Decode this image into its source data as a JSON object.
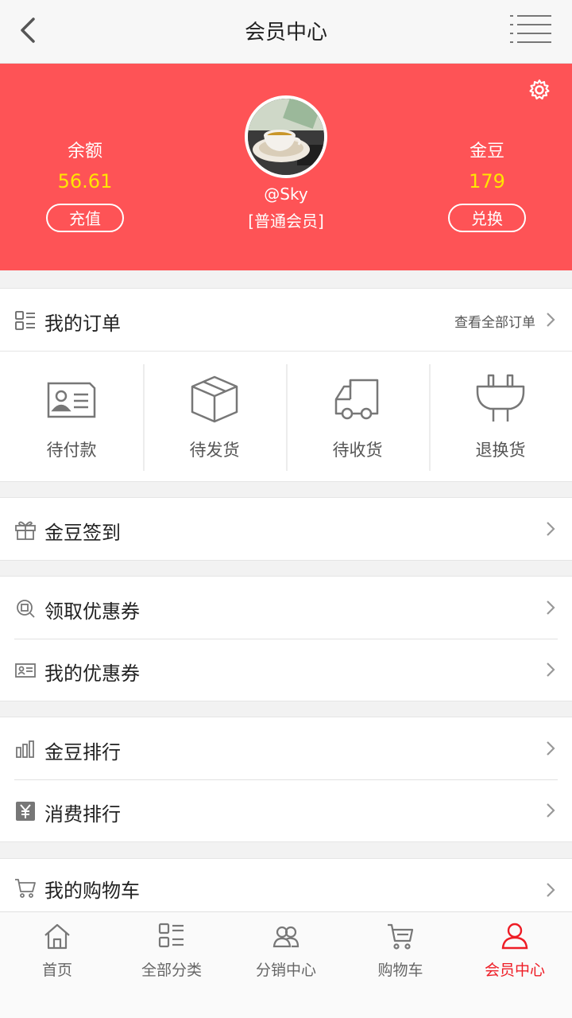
{
  "header": {
    "title": "会员中心",
    "back_icon": "back-arrow-icon",
    "menu_icon": "list-menu-icon"
  },
  "profile": {
    "balance_label": "余额",
    "balance_value": "56.61",
    "recharge_button": "充值",
    "username": "@Sky",
    "member_level": "[普通会员]",
    "beans_label": "金豆",
    "beans_value": "179",
    "exchange_button": "兑换",
    "colors": {
      "banner": "#fe5356",
      "value": "#ffe600"
    }
  },
  "orders": {
    "title": "我的订单",
    "view_all": "查看全部订单",
    "statuses": [
      {
        "label": "待付款",
        "icon": "payment-card-icon"
      },
      {
        "label": "待发货",
        "icon": "package-box-icon"
      },
      {
        "label": "待收货",
        "icon": "delivery-truck-icon"
      },
      {
        "label": "退换货",
        "icon": "plug-icon"
      }
    ]
  },
  "menu": {
    "checkin": "金豆签到",
    "get_coupon": "领取优惠券",
    "my_coupons": "我的优惠券",
    "bean_ranking": "金豆排行",
    "spend_ranking": "消费排行",
    "cart": "我的购物车"
  },
  "tabbar": {
    "items": [
      {
        "label": "首页",
        "icon": "home-icon"
      },
      {
        "label": "全部分类",
        "icon": "category-icon"
      },
      {
        "label": "分销中心",
        "icon": "distribution-icon"
      },
      {
        "label": "购物车",
        "icon": "cart-icon"
      },
      {
        "label": "会员中心",
        "icon": "user-icon"
      }
    ],
    "active_color": "#ee1c25"
  }
}
